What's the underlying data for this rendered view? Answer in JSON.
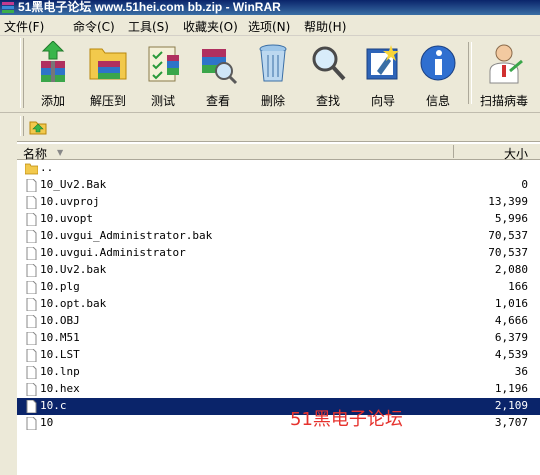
{
  "window": {
    "title": "51黑电子论坛 www.51hei.com bb.zip - WinRAR"
  },
  "menu": [
    "文件(F)",
    "命令(C)",
    "工具(S)",
    "收藏夹(O)",
    "选项(N)",
    "帮助(H)"
  ],
  "toolbar": [
    {
      "label": "添加",
      "icon": "add-archive-icon"
    },
    {
      "label": "解压到",
      "icon": "extract-to-icon"
    },
    {
      "label": "测试",
      "icon": "test-icon"
    },
    {
      "label": "查看",
      "icon": "view-icon"
    },
    {
      "label": "删除",
      "icon": "delete-icon"
    },
    {
      "label": "查找",
      "icon": "find-icon"
    },
    {
      "label": "向导",
      "icon": "wizard-icon"
    },
    {
      "label": "信息",
      "icon": "info-icon"
    },
    {
      "label": "扫描病毒",
      "icon": "virus-scan-icon"
    }
  ],
  "list": {
    "columns": {
      "name": "名称",
      "size": "大小"
    },
    "parent": "..",
    "files": [
      {
        "name": "10_Uv2.Bak",
        "size": "0"
      },
      {
        "name": "10.uvproj",
        "size": "13,399"
      },
      {
        "name": "10.uvopt",
        "size": "5,996"
      },
      {
        "name": "10.uvgui_Administrator.bak",
        "size": "70,537"
      },
      {
        "name": "10.uvgui.Administrator",
        "size": "70,537"
      },
      {
        "name": "10.Uv2.bak",
        "size": "2,080"
      },
      {
        "name": "10.plg",
        "size": "166"
      },
      {
        "name": "10.opt.bak",
        "size": "1,016"
      },
      {
        "name": "10.OBJ",
        "size": "4,666"
      },
      {
        "name": "10.M51",
        "size": "6,379"
      },
      {
        "name": "10.LST",
        "size": "4,539"
      },
      {
        "name": "10.lnp",
        "size": "36"
      },
      {
        "name": "10.hex",
        "size": "1,196"
      },
      {
        "name": "10.c",
        "size": "2,109",
        "selected": true
      },
      {
        "name": "10",
        "size": "3,707"
      }
    ]
  },
  "watermark": "51黑电子论坛",
  "colors": {
    "selection": "#0a246a",
    "watermark": "#e6322d",
    "chrome": "#ece9d8"
  }
}
